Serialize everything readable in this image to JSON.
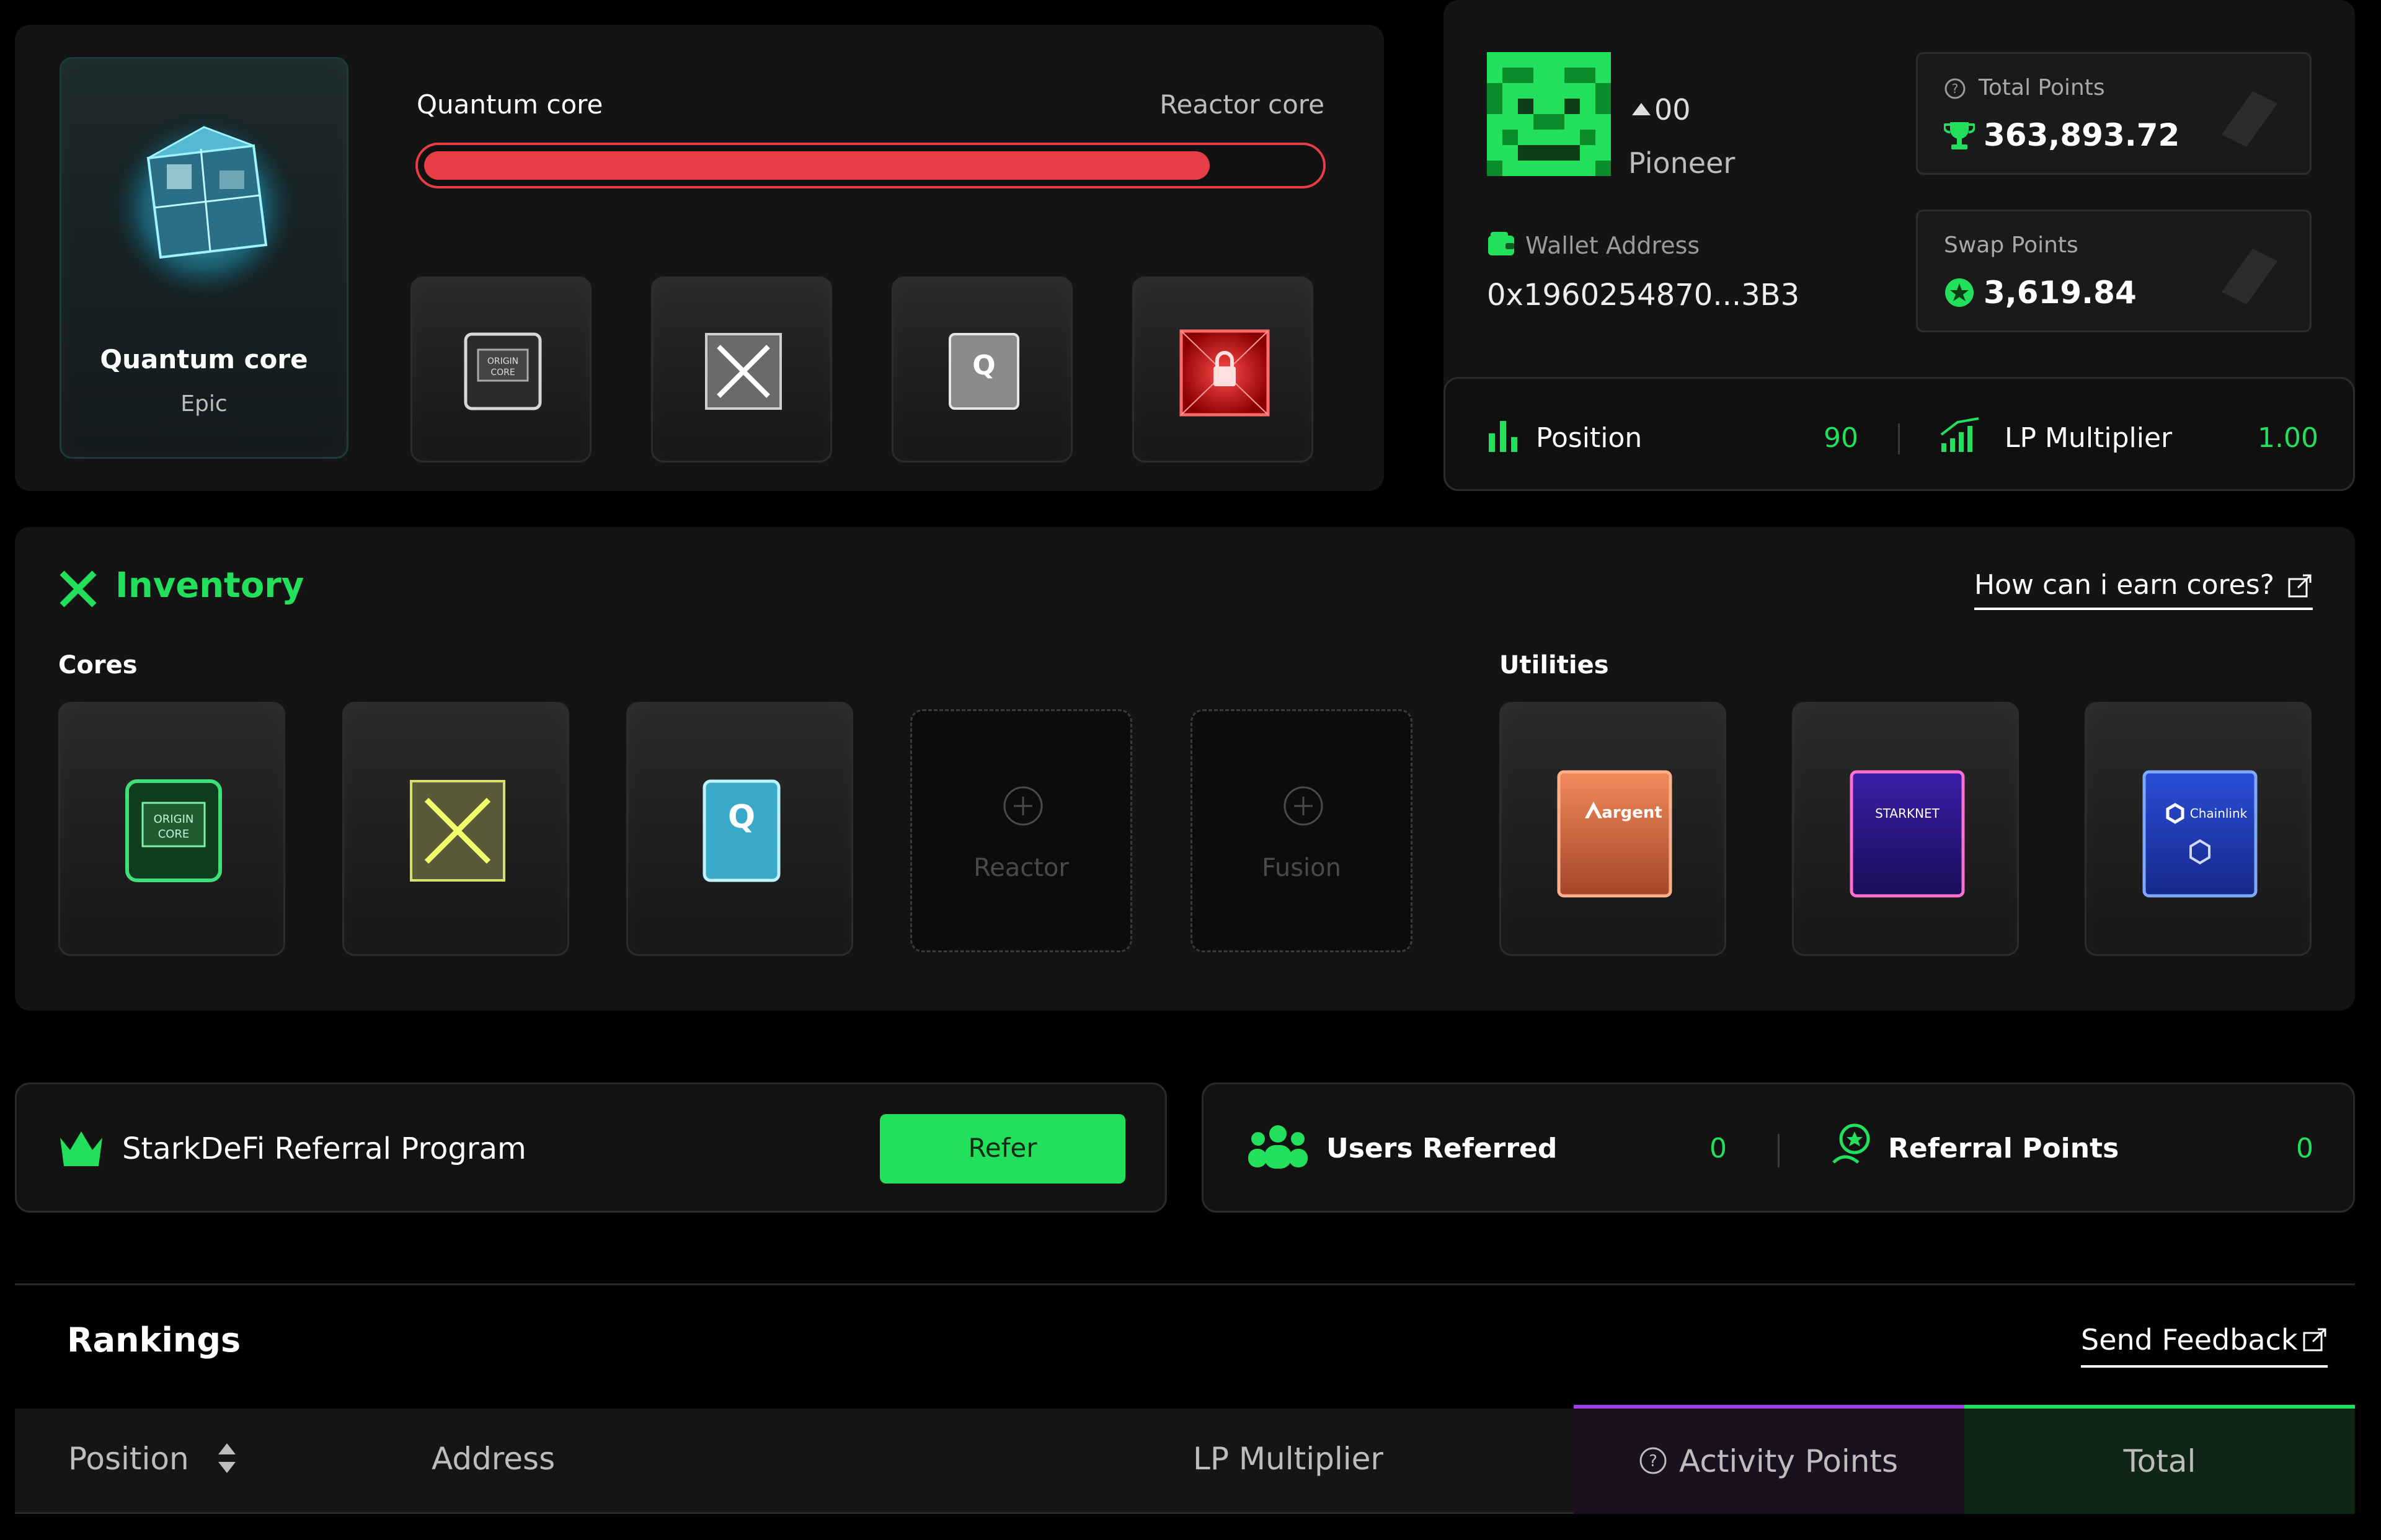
{
  "core_progress": {
    "current_core": "Quantum core",
    "rarity": "Epic",
    "left_label": "Quantum core",
    "right_label": "Reactor core",
    "progress": 0.88
  },
  "profile": {
    "rank_badge": "00",
    "rank_title": "Pioneer",
    "wallet_label": "Wallet Address",
    "wallet_value": "0x1960254870...3B3",
    "total_points_label": "Total Points",
    "total_points_value": "363,893.72",
    "swap_points_label": "Swap Points",
    "swap_points_value": "3,619.84",
    "position_label": "Position",
    "position_value": "90",
    "lp_label": "LP Multiplier",
    "lp_value": "1.00"
  },
  "inventory": {
    "title": "Inventory",
    "help_link": "How can i earn cores?",
    "cores_label": "Cores",
    "utilities_label": "Utilities",
    "empty_slots": [
      "Reactor",
      "Fusion"
    ],
    "utilities": [
      "argent",
      "STARKNET",
      "Chainlink"
    ]
  },
  "referral": {
    "title": "StarkDeFi Referral Program",
    "button": "Refer",
    "users_label": "Users Referred",
    "users_value": "0",
    "points_label": "Referral Points",
    "points_value": "0"
  },
  "rankings": {
    "title": "Rankings",
    "feedback_link": "Send Feedback",
    "columns": [
      "Position",
      "Address",
      "LP Multiplier",
      "Activity Points",
      "Total"
    ]
  },
  "colors": {
    "accent": "#22e05c",
    "progress": "#e63d46",
    "activity_header": "#a13de6"
  }
}
